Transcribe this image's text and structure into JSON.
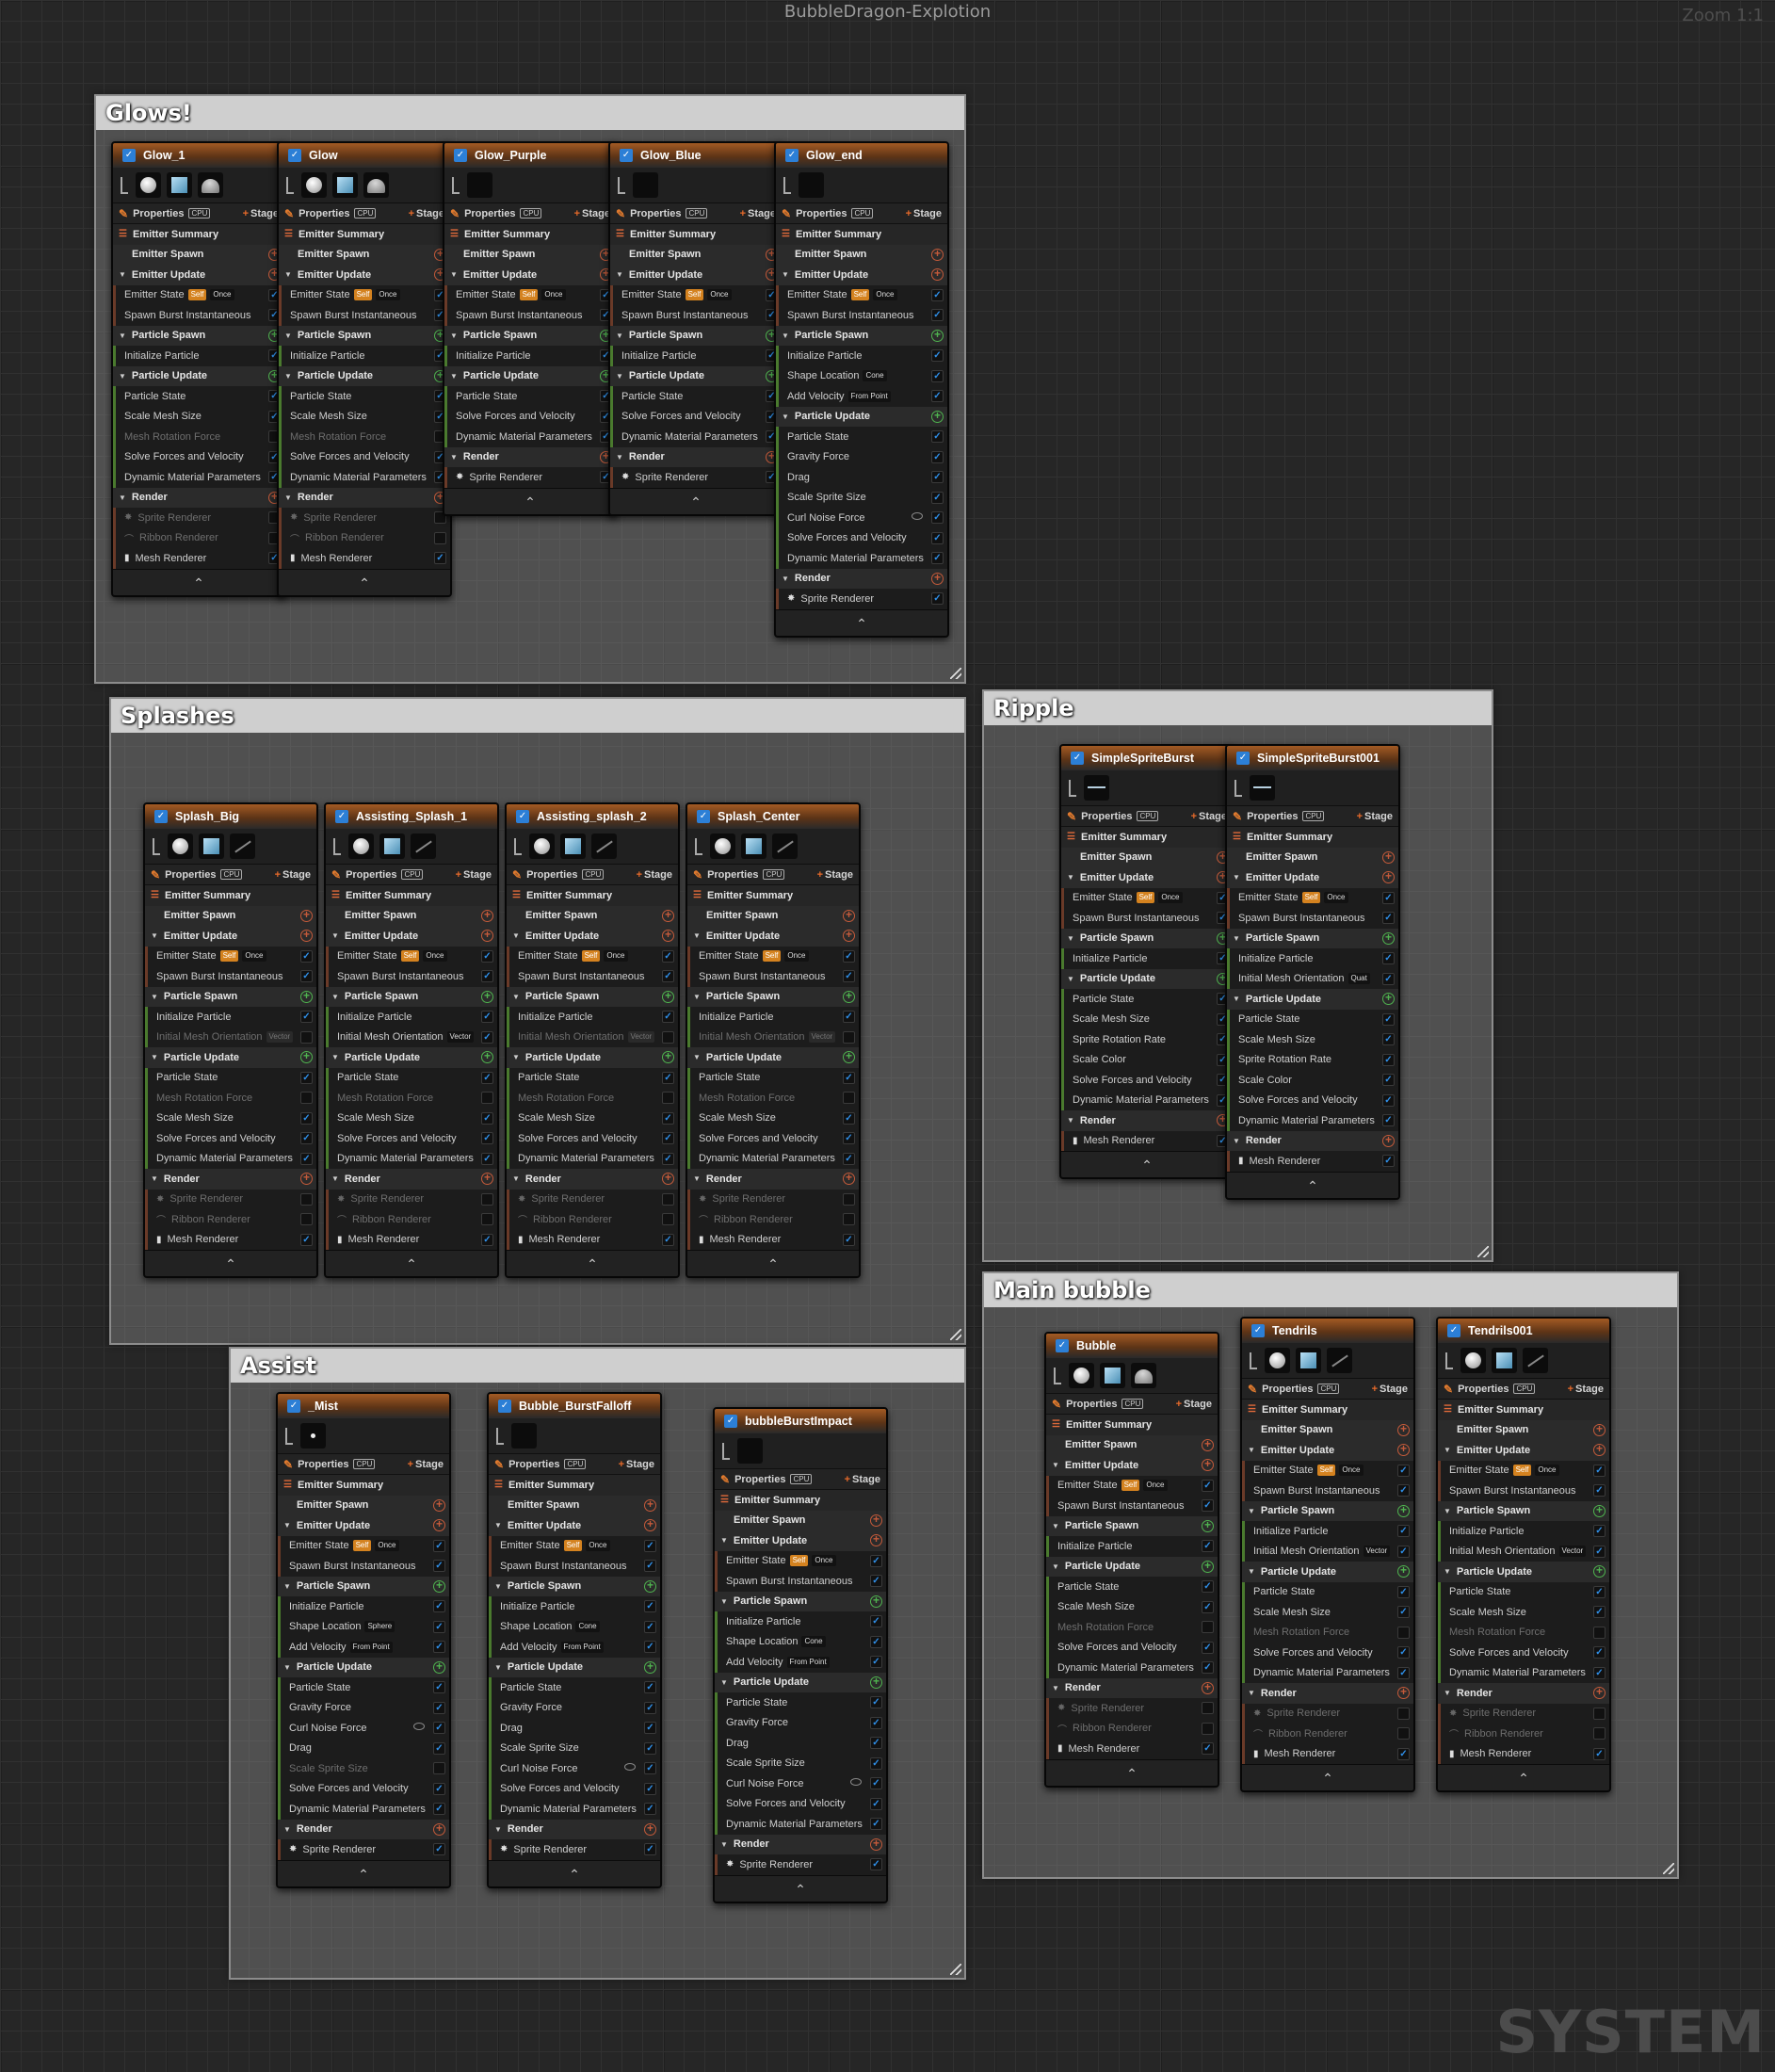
{
  "window": {
    "title": "BubbleDragon-Explotion",
    "zoom": "Zoom 1:1",
    "watermark": "SYSTEM"
  },
  "labels": {
    "properties": "Properties",
    "cpu": "CPU",
    "stage": "Stage",
    "emitter_summary": "Emitter Summary",
    "emitter_spawn": "Emitter Spawn",
    "emitter_update": "Emitter Update",
    "particle_spawn": "Particle Spawn",
    "particle_update": "Particle Update",
    "render": "Render"
  },
  "groups": [
    {
      "title": "Glows!",
      "emitters": [
        {
          "name": "Glow_1",
          "thumbs": [
            "sphere",
            "square",
            "dome"
          ],
          "spawn": [
            "Initialize Particle"
          ],
          "update": [
            "Particle State",
            "Scale Mesh Size",
            "~Mesh Rotation Force",
            "Solve Forces and Velocity",
            "Dynamic Material Parameters"
          ],
          "render": [
            "~Sprite Renderer",
            "~Ribbon Renderer",
            "Mesh Renderer"
          ]
        },
        {
          "name": "Glow",
          "thumbs": [
            "sphere",
            "square",
            "dome"
          ],
          "spawn": [
            "Initialize Particle"
          ],
          "update": [
            "Particle State",
            "Scale Mesh Size",
            "~Mesh Rotation Force",
            "Solve Forces and Velocity",
            "Dynamic Material Parameters"
          ],
          "render": [
            "~Sprite Renderer",
            "~Ribbon Renderer",
            "Mesh Renderer"
          ]
        },
        {
          "name": "Glow_Purple",
          "thumbs": [
            "dark"
          ],
          "spawn": [
            "Initialize Particle"
          ],
          "update": [
            "Particle State",
            "Solve Forces and Velocity",
            "Dynamic Material Parameters"
          ],
          "render": [
            "Sprite Renderer"
          ]
        },
        {
          "name": "Glow_Blue",
          "thumbs": [
            "dark"
          ],
          "spawn": [
            "Initialize Particle"
          ],
          "update": [
            "Particle State",
            "Solve Forces and Velocity",
            "Dynamic Material Parameters"
          ],
          "render": [
            "Sprite Renderer"
          ]
        },
        {
          "name": "Glow_end",
          "thumbs": [
            "dark"
          ],
          "spawn": [
            "Initialize Particle",
            "Shape Location|Cone",
            "Add Velocity|From Point"
          ],
          "update": [
            "Particle State",
            "Gravity Force",
            "Drag",
            "Scale Sprite Size",
            "Curl Noise Force@",
            "Solve Forces and Velocity",
            "Dynamic Material Parameters"
          ],
          "render": [
            "Sprite Renderer"
          ]
        }
      ]
    },
    {
      "title": "Splashes",
      "emitters": [
        {
          "name": "Splash_Big",
          "thumbs": [
            "sphere",
            "square",
            "slash"
          ],
          "spawn": [
            "Initialize Particle",
            "~Initial Mesh Orientation|Vector"
          ],
          "update": [
            "Particle State",
            "~Mesh Rotation Force",
            "Scale Mesh Size",
            "Solve Forces and Velocity",
            "Dynamic Material Parameters"
          ],
          "render": [
            "~Sprite Renderer",
            "~Ribbon Renderer",
            "Mesh Renderer"
          ]
        },
        {
          "name": "Assisting_Splash_1",
          "thumbs": [
            "sphere",
            "square",
            "slash"
          ],
          "spawn": [
            "Initialize Particle",
            "Initial Mesh Orientation|Vector"
          ],
          "update": [
            "Particle State",
            "~Mesh Rotation Force",
            "Scale Mesh Size",
            "Solve Forces and Velocity",
            "Dynamic Material Parameters"
          ],
          "render": [
            "~Sprite Renderer",
            "~Ribbon Renderer",
            "Mesh Renderer"
          ]
        },
        {
          "name": "Assisting_splash_2",
          "thumbs": [
            "sphere",
            "square",
            "slash"
          ],
          "spawn": [
            "Initialize Particle",
            "~Initial Mesh Orientation|Vector"
          ],
          "update": [
            "Particle State",
            "~Mesh Rotation Force",
            "Scale Mesh Size",
            "Solve Forces and Velocity",
            "Dynamic Material Parameters"
          ],
          "render": [
            "~Sprite Renderer",
            "~Ribbon Renderer",
            "Mesh Renderer"
          ]
        },
        {
          "name": "Splash_Center",
          "thumbs": [
            "sphere",
            "square",
            "slash"
          ],
          "spawn": [
            "Initialize Particle",
            "~Initial Mesh Orientation|Vector"
          ],
          "update": [
            "Particle State",
            "~Mesh Rotation Force",
            "Scale Mesh Size",
            "Solve Forces and Velocity",
            "Dynamic Material Parameters"
          ],
          "render": [
            "~Sprite Renderer",
            "~Ribbon Renderer",
            "Mesh Renderer"
          ]
        }
      ]
    },
    {
      "title": "Ripple",
      "emitters": [
        {
          "name": "SimpleSpriteBurst",
          "thumbs": [
            "wave"
          ],
          "spawn": [
            "Initialize Particle"
          ],
          "update": [
            "Particle State",
            "Scale Mesh Size",
            "Sprite Rotation Rate",
            "Scale Color",
            "Solve Forces and Velocity",
            "Dynamic Material Parameters"
          ],
          "render": [
            "Mesh Renderer"
          ]
        },
        {
          "name": "SimpleSpriteBurst001",
          "thumbs": [
            "wave"
          ],
          "spawn": [
            "Initialize Particle",
            "Initial Mesh Orientation|Quat"
          ],
          "update": [
            "Particle State",
            "Scale Mesh Size",
            "Sprite Rotation Rate",
            "Scale Color",
            "Solve Forces and Velocity",
            "Dynamic Material Parameters"
          ],
          "render": [
            "Mesh Renderer"
          ]
        }
      ]
    },
    {
      "title": "Main bubble",
      "emitters": [
        {
          "name": "Bubble",
          "thumbs": [
            "sphere",
            "square",
            "dome"
          ],
          "spawn": [
            "Initialize Particle"
          ],
          "update": [
            "Particle State",
            "Scale Mesh Size",
            "~Mesh Rotation Force",
            "Solve Forces and Velocity",
            "Dynamic Material Parameters"
          ],
          "render": [
            "~Sprite Renderer",
            "~Ribbon Renderer",
            "Mesh Renderer"
          ]
        },
        {
          "name": "Tendrils",
          "thumbs": [
            "sphere",
            "square",
            "slash"
          ],
          "spawn": [
            "Initialize Particle",
            "Initial Mesh Orientation|Vector"
          ],
          "update": [
            "Particle State",
            "Scale Mesh Size",
            "~Mesh Rotation Force",
            "Solve Forces and Velocity",
            "Dynamic Material Parameters"
          ],
          "render": [
            "~Sprite Renderer",
            "~Ribbon Renderer",
            "Mesh Renderer"
          ]
        },
        {
          "name": "Tendrils001",
          "thumbs": [
            "sphere",
            "square",
            "slash"
          ],
          "spawn": [
            "Initialize Particle",
            "Initial Mesh Orientation|Vector"
          ],
          "update": [
            "Particle State",
            "Scale Mesh Size",
            "~Mesh Rotation Force",
            "Solve Forces and Velocity",
            "Dynamic Material Parameters"
          ],
          "render": [
            "~Sprite Renderer",
            "~Ribbon Renderer",
            "Mesh Renderer"
          ]
        }
      ]
    },
    {
      "title": "Assist",
      "emitters": [
        {
          "name": "_Mist",
          "thumbs": [
            "dot"
          ],
          "spawn": [
            "Initialize Particle",
            "Shape Location|Sphere",
            "Add Velocity|From Point"
          ],
          "update": [
            "Particle State",
            "Gravity Force",
            "Curl Noise Force@",
            "Drag",
            "~Scale Sprite Size",
            "Solve Forces and Velocity",
            "Dynamic Material Parameters"
          ],
          "render": [
            "Sprite Renderer"
          ]
        },
        {
          "name": "Bubble_BurstFalloff",
          "thumbs": [
            "dark"
          ],
          "spawn": [
            "Initialize Particle",
            "Shape Location|Cone",
            "Add Velocity|From Point"
          ],
          "update": [
            "Particle State",
            "Gravity Force",
            "Drag",
            "Scale Sprite Size",
            "Curl Noise Force@",
            "Solve Forces and Velocity",
            "Dynamic Material Parameters"
          ],
          "render": [
            "Sprite Renderer"
          ]
        },
        {
          "name": "bubbleBurstImpact",
          "thumbs": [
            "dark"
          ],
          "spawn": [
            "Initialize Particle",
            "Shape Location|Cone",
            "Add Velocity|From Point"
          ],
          "update": [
            "Particle State",
            "Gravity Force",
            "Drag",
            "Scale Sprite Size",
            "Curl Noise Force@",
            "Solve Forces and Velocity",
            "Dynamic Material Parameters"
          ],
          "render": [
            "Sprite Renderer"
          ]
        }
      ]
    }
  ]
}
